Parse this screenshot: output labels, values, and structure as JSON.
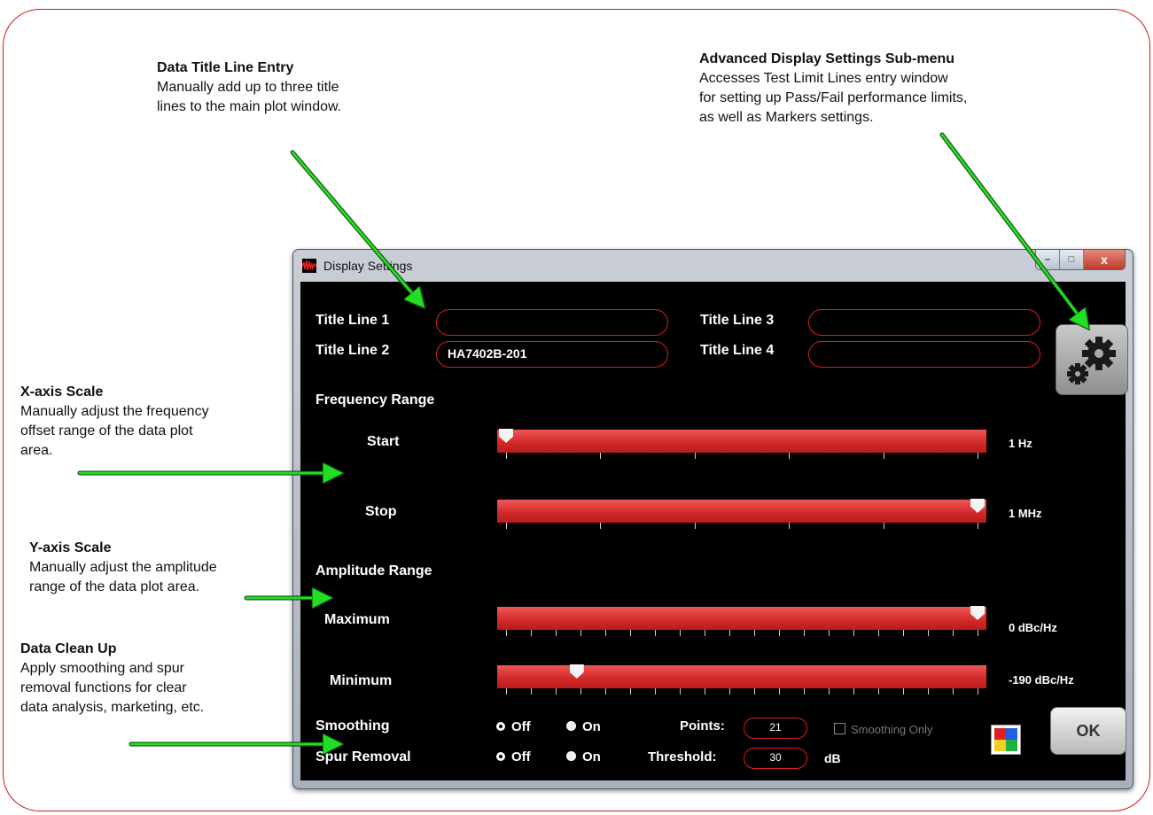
{
  "annotations": {
    "data_title": {
      "title": "Data Title Line Entry",
      "lines": [
        "Manually add up to three title",
        "lines to the main plot window."
      ]
    },
    "advanced": {
      "title": "Advanced Display Settings Sub-menu",
      "lines": [
        "Accesses Test Limit Lines entry window",
        "for setting up Pass/Fail performance limits,",
        "as well as Markers settings."
      ]
    },
    "x_axis": {
      "title": "X-axis Scale",
      "lines": [
        "Manually adjust the frequency",
        "offset range of the data plot",
        "area."
      ]
    },
    "y_axis": {
      "title": "Y-axis Scale",
      "lines": [
        "Manually adjust the amplitude",
        "range of the data plot area."
      ]
    },
    "cleanup": {
      "title": "Data Clean Up",
      "lines": [
        "Apply smoothing and spur",
        "removal functions for clear",
        "data analysis, marketing, etc."
      ]
    }
  },
  "window": {
    "title": "Display Settings",
    "controls": {
      "minimize": "–",
      "maximize": "□",
      "close": "x"
    }
  },
  "titles": {
    "line1": {
      "label": "Title Line 1",
      "value": ""
    },
    "line2": {
      "label": "Title Line 2",
      "value": "HA7402B-201"
    },
    "line3": {
      "label": "Title Line 3",
      "value": ""
    },
    "line4": {
      "label": "Title Line 4",
      "value": ""
    }
  },
  "frequency": {
    "section": "Frequency Range",
    "start": {
      "label": "Start",
      "value": "1 Hz",
      "level": 0.0,
      "ticks": 6
    },
    "stop": {
      "label": "Stop",
      "value": "1 MHz",
      "level": 1.0,
      "ticks": 6
    }
  },
  "amplitude": {
    "section": "Amplitude Range",
    "maximum": {
      "label": "Maximum",
      "value": "0 dBc/Hz",
      "level": 1.0,
      "ticks": 20
    },
    "minimum": {
      "label": "Minimum",
      "value": "-190 dBc/Hz",
      "level": 0.15,
      "ticks": 20
    }
  },
  "smoothing": {
    "label": "Smoothing",
    "off": "Off",
    "on": "On",
    "selected": "off",
    "points_label": "Points:",
    "points": "21",
    "only_label": "Smoothing Only",
    "only_checked": false
  },
  "spur": {
    "label": "Spur Removal",
    "off": "Off",
    "on": "On",
    "selected": "off",
    "threshold_label": "Threshold:",
    "threshold": "30",
    "unit": "dB"
  },
  "buttons": {
    "ok": "OK",
    "advanced_icon": "gears-icon",
    "color_icon": "color-palette-icon"
  },
  "colors": {
    "accent": "#d42a2a",
    "arrow": "#22dd22",
    "frame": "#d01818"
  }
}
